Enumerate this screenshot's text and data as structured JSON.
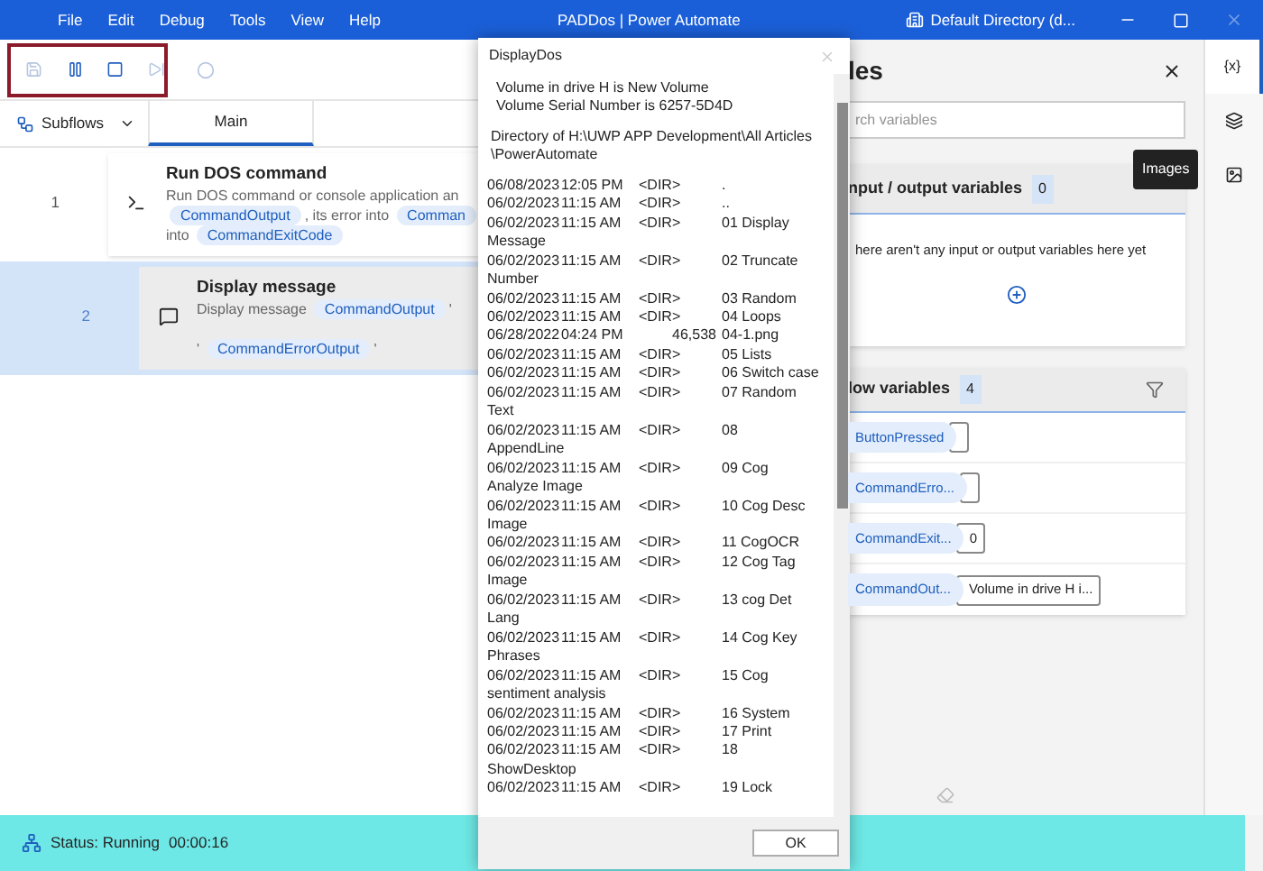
{
  "window": {
    "menu": [
      "File",
      "Edit",
      "Debug",
      "Tools",
      "View",
      "Help"
    ],
    "title": "PADDos | Power Automate",
    "account": "Default Directory (d..."
  },
  "toolbar": [
    {
      "kind": "save",
      "disabled": true
    },
    {
      "kind": "pause",
      "disabled": false
    },
    {
      "kind": "stop",
      "disabled": false
    },
    {
      "kind": "next",
      "disabled": true
    },
    {
      "kind": "record",
      "disabled": true
    }
  ],
  "subflows": {
    "label": "Subflows"
  },
  "tabs": [
    {
      "label": "Main",
      "selected": true
    }
  ],
  "actions": [
    {
      "number": "1",
      "title": "Run DOS command",
      "selected": false,
      "kind": "console",
      "lines": [
        [
          {
            "kind": "text",
            "text": "Run DOS command or console application an"
          }
        ],
        [
          {
            "kind": "chip",
            "text": "CommandOutput"
          },
          {
            "kind": "text",
            "text": ", its error into"
          },
          {
            "kind": "chip",
            "text": "Comman"
          }
        ],
        [
          {
            "kind": "text",
            "text": "into"
          },
          {
            "kind": "chip",
            "text": "CommandExitCode"
          }
        ]
      ]
    },
    {
      "number": "2",
      "title": "Display message",
      "selected": true,
      "kind": "message",
      "lines": [
        [
          {
            "kind": "text",
            "text": "Display message"
          },
          {
            "kind": "chip",
            "text": "CommandOutput"
          },
          {
            "kind": "text",
            "text": "'"
          }
        ],
        [
          {
            "kind": "text",
            "text": "'"
          },
          {
            "kind": "chip",
            "text": "CommandErrorOutput"
          },
          {
            "kind": "text",
            "text": "'"
          }
        ]
      ]
    }
  ],
  "status_bar": {
    "status": "Status: Running",
    "time": "00:00:16"
  },
  "variables": {
    "title": "les",
    "search": {
      "placeholder": "rch variables"
    },
    "io": {
      "title": "nput / output variables",
      "count": "0",
      "empty": "here aren't any input or output variables here yet"
    },
    "flow": {
      "title": "low variables",
      "count": "4",
      "items": [
        {
          "name": "ButtonPressed",
          "value": ""
        },
        {
          "name": "CommandErro...",
          "value": ""
        },
        {
          "name": "CommandExit...",
          "value": "0"
        },
        {
          "name": "CommandOut...",
          "value": "Volume in drive H i..."
        }
      ]
    }
  },
  "side_tabs": [
    {
      "kind": "variables",
      "label": "{x}",
      "selected": true
    },
    {
      "kind": "layers",
      "selected": false
    },
    {
      "kind": "images",
      "selected": false
    }
  ],
  "tooltip": "Images",
  "dialog": {
    "title": "DisplayDos",
    "header": [
      [
        "Volume in drive H is New Volume",
        "Volume Serial Number is 6257-5D4D"
      ],
      [
        "Directory of H:\\UWP APP Development\\All Articles",
        "\\PowerAutomate"
      ]
    ],
    "lines": [
      {
        "kind": "entry",
        "date": "06/08/2023",
        "time": "12:05 PM",
        "dir": "<DIR>",
        "name": "."
      },
      {
        "kind": "entry",
        "date": "06/02/2023",
        "time": "11:15 AM",
        "dir": "<DIR>",
        "name": ".."
      },
      {
        "kind": "entry",
        "date": "06/02/2023",
        "time": "11:15 AM",
        "dir": "<DIR>",
        "name": "01 Display"
      },
      {
        "kind": "wrap",
        "text": "Message"
      },
      {
        "kind": "entry",
        "date": "06/02/2023",
        "time": "11:15 AM",
        "dir": "<DIR>",
        "name": "02 Truncate"
      },
      {
        "kind": "wrap",
        "text": "Number"
      },
      {
        "kind": "entry",
        "date": "06/02/2023",
        "time": "11:15 AM",
        "dir": "<DIR>",
        "name": "03 Random"
      },
      {
        "kind": "entry",
        "date": "06/02/2023",
        "time": "11:15 AM",
        "dir": "<DIR>",
        "name": "04 Loops"
      },
      {
        "kind": "file",
        "date": "06/28/2022",
        "time": "04:24 PM",
        "size": "46,538",
        "name": "04-1.png"
      },
      {
        "kind": "entry",
        "date": "06/02/2023",
        "time": "11:15 AM",
        "dir": "<DIR>",
        "name": "05 Lists"
      },
      {
        "kind": "entry",
        "date": "06/02/2023",
        "time": "11:15 AM",
        "dir": "<DIR>",
        "name": "06 Switch case"
      },
      {
        "kind": "entry",
        "date": "06/02/2023",
        "time": "11:15 AM",
        "dir": "<DIR>",
        "name": "07 Random"
      },
      {
        "kind": "wrap",
        "text": "Text"
      },
      {
        "kind": "entry",
        "date": "06/02/2023",
        "time": "11:15 AM",
        "dir": "<DIR>",
        "name": "08"
      },
      {
        "kind": "wrap",
        "text": "AppendLine"
      },
      {
        "kind": "entry",
        "date": "06/02/2023",
        "time": "11:15 AM",
        "dir": "<DIR>",
        "name": "09 Cog"
      },
      {
        "kind": "wrap",
        "text": "Analyze Image"
      },
      {
        "kind": "entry",
        "date": "06/02/2023",
        "time": "11:15 AM",
        "dir": "<DIR>",
        "name": "10 Cog Desc"
      },
      {
        "kind": "wrap",
        "text": "Image"
      },
      {
        "kind": "entry",
        "date": "06/02/2023",
        "time": "11:15 AM",
        "dir": "<DIR>",
        "name": "11 CogOCR"
      },
      {
        "kind": "entry",
        "date": "06/02/2023",
        "time": "11:15 AM",
        "dir": "<DIR>",
        "name": "12 Cog Tag"
      },
      {
        "kind": "wrap",
        "text": "Image"
      },
      {
        "kind": "entry",
        "date": "06/02/2023",
        "time": "11:15 AM",
        "dir": "<DIR>",
        "name": "13 cog Det"
      },
      {
        "kind": "wrap",
        "text": "Lang"
      },
      {
        "kind": "entry",
        "date": "06/02/2023",
        "time": "11:15 AM",
        "dir": "<DIR>",
        "name": "14 Cog Key"
      },
      {
        "kind": "wrap",
        "text": "Phrases"
      },
      {
        "kind": "entry",
        "date": "06/02/2023",
        "time": "11:15 AM",
        "dir": "<DIR>",
        "name": "15 Cog"
      },
      {
        "kind": "wrap",
        "text": "sentiment analysis"
      },
      {
        "kind": "entry",
        "date": "06/02/2023",
        "time": "11:15 AM",
        "dir": "<DIR>",
        "name": "16 System"
      },
      {
        "kind": "entry",
        "date": "06/02/2023",
        "time": "11:15 AM",
        "dir": "<DIR>",
        "name": "17 Print"
      },
      {
        "kind": "entry",
        "date": "06/02/2023",
        "time": "11:15 AM",
        "dir": "<DIR>",
        "name": "18"
      },
      {
        "kind": "wrap",
        "text": "ShowDesktop"
      },
      {
        "kind": "entry",
        "date": "06/02/2023",
        "time": "11:15 AM",
        "dir": "<DIR>",
        "name": "19 Lock"
      }
    ],
    "button": "OK"
  }
}
